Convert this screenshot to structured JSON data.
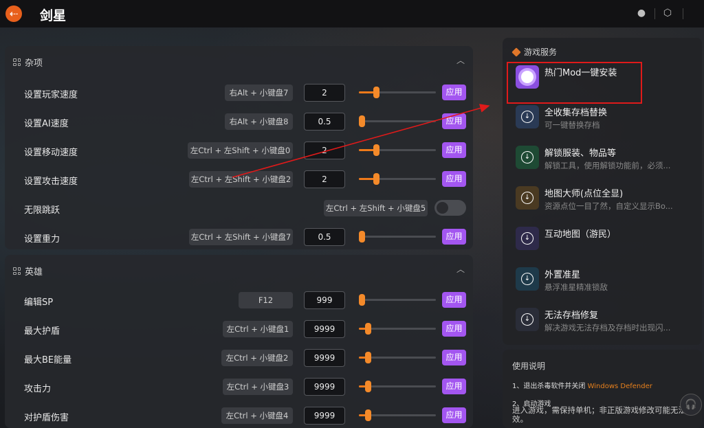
{
  "app": {
    "title": "剑星"
  },
  "titlebar": {
    "back_icon": "back-arrow-icon",
    "icons": [
      "user-icon",
      "settings-icon"
    ]
  },
  "accent": {
    "apply": "#a356f0",
    "slider": "#ef7a1a",
    "back": "#e8601c",
    "highlight": "#e01a1a"
  },
  "sections": [
    {
      "title": "杂项",
      "rows": [
        {
          "label": "设置玩家速度",
          "hotkey": "右Alt + 小键盘7",
          "value": "2",
          "slider": 0.2,
          "control": "slider",
          "apply": "应用"
        },
        {
          "label": "设置AI速度",
          "hotkey": "右Alt + 小键盘8",
          "value": "0.5",
          "slider": 0.0,
          "control": "slider",
          "apply": "应用"
        },
        {
          "label": "设置移动速度",
          "hotkey": "左Ctrl + 左Shift + 小键盘0",
          "value": "2",
          "slider": 0.2,
          "control": "slider",
          "apply": "应用"
        },
        {
          "label": "设置攻击速度",
          "hotkey": "左Ctrl + 左Shift + 小键盘2",
          "value": "2",
          "slider": 0.2,
          "control": "slider",
          "apply": "应用"
        },
        {
          "label": "无限跳跃",
          "hotkey": "左Ctrl + 左Shift + 小键盘5",
          "control": "toggle",
          "toggle_on": false
        },
        {
          "label": "设置重力",
          "hotkey": "左Ctrl + 左Shift + 小键盘7",
          "value": "0.5",
          "slider": 0.0,
          "control": "slider",
          "apply": "应用"
        }
      ]
    },
    {
      "title": "英雄",
      "rows": [
        {
          "label": "编辑SP",
          "hotkey": "F12",
          "value": "999",
          "slider": 0.0,
          "control": "slider",
          "apply": "应用"
        },
        {
          "label": "最大护盾",
          "hotkey": "左Ctrl + 小键盘1",
          "value": "9999",
          "slider": 0.09,
          "control": "slider",
          "apply": "应用"
        },
        {
          "label": "最大BE能量",
          "hotkey": "左Ctrl + 小键盘2",
          "value": "9999",
          "slider": 0.09,
          "control": "slider",
          "apply": "应用"
        },
        {
          "label": "攻击力",
          "hotkey": "左Ctrl + 小键盘3",
          "value": "9999",
          "slider": 0.09,
          "control": "slider",
          "apply": "应用"
        },
        {
          "label": "对护盾伤害",
          "hotkey": "左Ctrl + 小键盘4",
          "value": "9999",
          "slider": 0.09,
          "control": "slider",
          "apply": "应用"
        }
      ]
    }
  ],
  "services": {
    "title": "游戏服务",
    "items": [
      {
        "title": "热门Mod一键安装",
        "subtitle": "",
        "icon": "mod-flower-icon",
        "color": "#8a4fe0"
      },
      {
        "title": "全收集存档替换",
        "subtitle": "可一键替换存档",
        "icon": "download-icon",
        "color": "#2a3a55"
      },
      {
        "title": "解锁服装、物品等",
        "subtitle": "解锁工具，使用解锁功能前，必须...",
        "icon": "download-icon",
        "color": "#1e4a34"
      },
      {
        "title": "地图大师(点位全显)",
        "subtitle": "资源点位一目了然，自定义显示Bo...",
        "icon": "download-icon",
        "color": "#4a3a22"
      },
      {
        "title": "互动地图（游民）",
        "subtitle": "",
        "icon": "download-icon",
        "color": "#2e2a4a"
      },
      {
        "title": "外置准星",
        "subtitle": "悬浮准星精准锁敌",
        "icon": "download-icon",
        "color": "#1e3a4a"
      },
      {
        "title": "无法存档修复",
        "subtitle": "解决游戏无法存档及存档时出现闪...",
        "icon": "download-icon",
        "color": "#2a2d38"
      }
    ]
  },
  "usage": {
    "title": "使用说明",
    "step1_prefix": "1、退出杀毒软件并关闭",
    "step1_highlight": "Windows Defender",
    "step2": "2、启动游戏",
    "step2_body": "进入游戏，需保持单机；非正版游戏修改可能无法生效。"
  },
  "support": {
    "icon": "headset-icon"
  }
}
